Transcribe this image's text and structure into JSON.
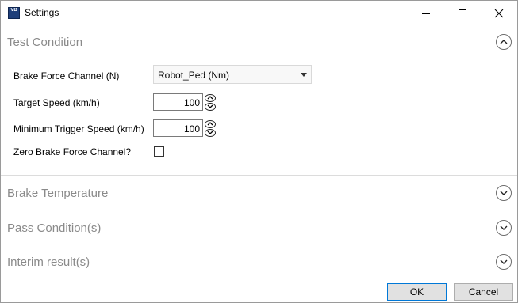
{
  "window": {
    "title": "Settings",
    "icon": "app-logo-icon",
    "icon_text": "VB"
  },
  "sections": {
    "test_condition": {
      "title": "Test Condition",
      "expanded": true,
      "fields": {
        "brake_force_channel": {
          "label": "Brake Force Channel (N)",
          "value": "Robot_Ped (Nm)"
        },
        "target_speed": {
          "label": "Target Speed (km/h)",
          "value": "100"
        },
        "min_trigger_speed": {
          "label": "Minimum Trigger Speed (km/h)",
          "value": "100"
        },
        "zero_brake_force": {
          "label": "Zero Brake Force Channel?",
          "checked": false
        }
      }
    },
    "brake_temperature": {
      "title": "Brake Temperature",
      "expanded": false
    },
    "pass_conditions": {
      "title": "Pass Condition(s)",
      "expanded": false
    },
    "interim_results": {
      "title": "Interim result(s)",
      "expanded": false
    }
  },
  "footer": {
    "ok_label": "OK",
    "cancel_label": "Cancel"
  },
  "colors": {
    "section_title": "#8a8a8a",
    "accent_focus": "#0078d7",
    "icon_bg": "#1f3f7a"
  }
}
